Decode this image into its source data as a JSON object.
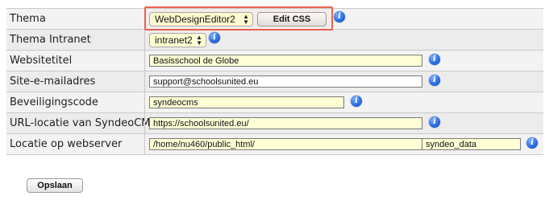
{
  "rows": [
    {
      "label": "Thema",
      "select": "WebDesignEditor2",
      "button": "Edit CSS"
    },
    {
      "label": "Thema Intranet",
      "select": "intranet2"
    },
    {
      "label": "Websitetitel",
      "value": "Basisschool de Globe"
    },
    {
      "label": "Site-e-mailadres",
      "value": "support@schoolsunited.eu"
    },
    {
      "label": "Beveiligingscode",
      "value": "syndeocms"
    },
    {
      "label": "URL-locatie van SyndeoCMS",
      "value": "https://schoolsunited.eu/"
    },
    {
      "label": "Locatie op webserver",
      "value": "/home/nu460/public_html/",
      "value2": "syndeo_data"
    }
  ],
  "save_label": "Opslaan",
  "icons": {
    "info": "info-icon",
    "select_arrows": "updown-arrows-icon"
  },
  "colors": {
    "field_bg": "#ffffd6",
    "row_bg": "#f3f3f3",
    "highlight": "#e8624f",
    "info": "#2d6fe0"
  }
}
